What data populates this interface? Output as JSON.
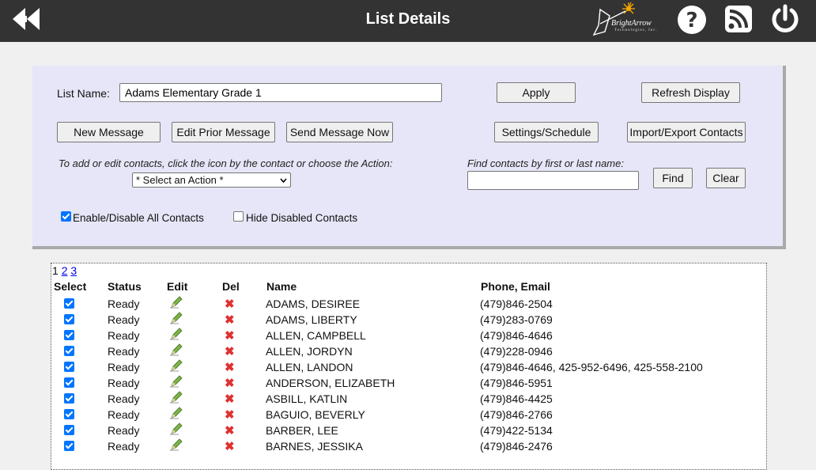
{
  "header": {
    "title": "List Details",
    "logo_brand": "BrightArrow",
    "logo_sub": "Technologies, Inc.",
    "icons": [
      "back-icon",
      "help-icon",
      "rss-icon",
      "power-icon"
    ]
  },
  "form": {
    "list_name_label": "List Name:",
    "list_name_value": "Adams Elementary Grade 1",
    "apply_label": "Apply",
    "refresh_label": "Refresh Display",
    "new_message_label": "New Message",
    "edit_prior_label": "Edit Prior Message",
    "send_now_label": "Send Message Now",
    "settings_label": "Settings/Schedule",
    "import_export_label": "Import/Export Contacts",
    "action_hint": "To add or edit contacts, click the icon by the contact or choose the Action:",
    "action_select_value": "* Select an Action *",
    "find_hint": "Find contacts by first or last name:",
    "find_value": "",
    "find_label": "Find",
    "clear_label": "Clear",
    "enable_all_label": "Enable/Disable All Contacts",
    "enable_all_checked": true,
    "hide_disabled_label": "Hide Disabled Contacts",
    "hide_disabled_checked": false
  },
  "table": {
    "pages": {
      "current": "1",
      "others": [
        "2",
        "3"
      ]
    },
    "columns": [
      "Select",
      "Status",
      "Edit",
      "Del",
      "Name",
      "Phone, Email"
    ],
    "rows": [
      {
        "status": "Ready",
        "name": "ADAMS, DESIREE",
        "phone": "(479)846-2504"
      },
      {
        "status": "Ready",
        "name": "ADAMS, LIBERTY",
        "phone": "(479)283-0769"
      },
      {
        "status": "Ready",
        "name": "ALLEN, CAMPBELL",
        "phone": "(479)846-4646"
      },
      {
        "status": "Ready",
        "name": "ALLEN, JORDYN",
        "phone": "(479)228-0946"
      },
      {
        "status": "Ready",
        "name": "ALLEN, LANDON",
        "phone": "(479)846-4646, 425-952-6496, 425-558-2100"
      },
      {
        "status": "Ready",
        "name": "ANDERSON, ELIZABETH",
        "phone": "(479)846-5951"
      },
      {
        "status": "Ready",
        "name": "ASBILL, KATLIN",
        "phone": "(479)846-4425"
      },
      {
        "status": "Ready",
        "name": "BAGUIO, BEVERLY",
        "phone": "(479)846-2766"
      },
      {
        "status": "Ready",
        "name": "BARBER, LEE",
        "phone": "(479)422-5134"
      },
      {
        "status": "Ready",
        "name": "BARNES, JESSIKA",
        "phone": "(479)846-2476"
      }
    ]
  }
}
